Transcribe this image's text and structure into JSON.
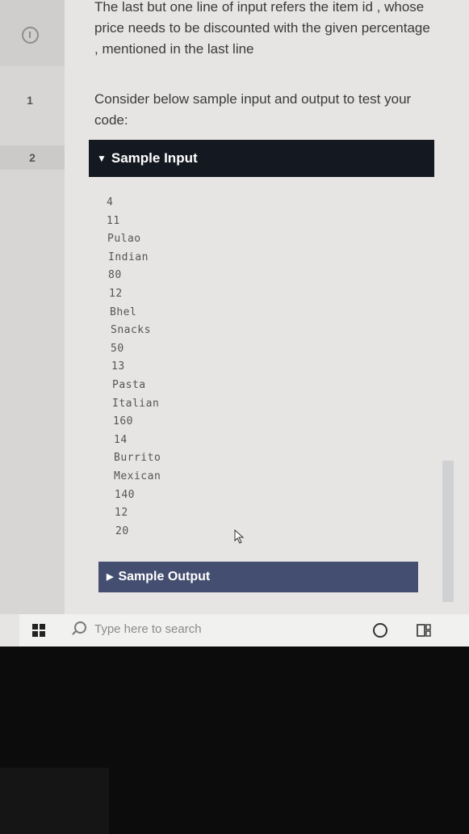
{
  "left_rail": {
    "items": [
      {
        "label": "1"
      },
      {
        "label": "2"
      }
    ]
  },
  "content": {
    "paragraph_1": "The last but one line of input refers the item id , whose price needs to be discounted with the given percentage , mentioned in the last line",
    "paragraph_2": "Consider below sample input and output to test your code:",
    "sample_input": {
      "label": "Sample Input",
      "lines": [
        "4",
        "11",
        "Pulao",
        "Indian",
        "80",
        "12",
        "Bhel",
        "Snacks",
        "50",
        "13",
        "Pasta",
        "Italian",
        "160",
        "14",
        "Burrito",
        "Mexican",
        "140",
        "12",
        "20"
      ]
    },
    "sample_output": {
      "label": "Sample Output"
    }
  },
  "taskbar": {
    "search_placeholder": "Type here to search"
  }
}
